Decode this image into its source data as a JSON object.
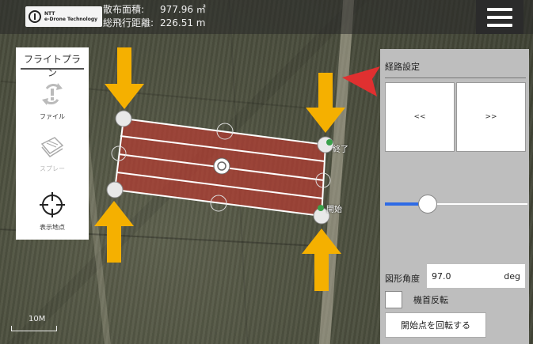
{
  "header": {
    "logo_text_1": "NTT",
    "logo_text_2": "e-Drone Technology",
    "area_label": "散布面積:",
    "area_value": "977.96 ㎡",
    "distance_label": "総飛行距離:",
    "distance_value": "226.51 m"
  },
  "left_panel": {
    "title": "フライトプラン",
    "items": [
      {
        "label": "ファイル",
        "icon": "file-sync-icon",
        "enabled": true
      },
      {
        "label": "スプレー",
        "icon": "spray-layers-icon",
        "enabled": false
      },
      {
        "label": "表示地点",
        "icon": "crosshair-icon",
        "enabled": true
      }
    ]
  },
  "map": {
    "end_label": "終了",
    "start_label": "開始",
    "scale_label": "10M"
  },
  "right_panel": {
    "title": "経路設定",
    "prev_label": "<<",
    "next_label": ">>",
    "slider_value": 0.3,
    "angle_label": "図形角度",
    "angle_value": "97.0",
    "angle_unit": "deg",
    "flip_label": "機首反転",
    "flip_checked": false,
    "rotate_button_label": "開始点を回転する"
  },
  "colors": {
    "polygon_fill": "#b43c32",
    "arrow": "#f5b000",
    "pointer_red": "#e03030",
    "slider_blue": "#2e6be6"
  }
}
